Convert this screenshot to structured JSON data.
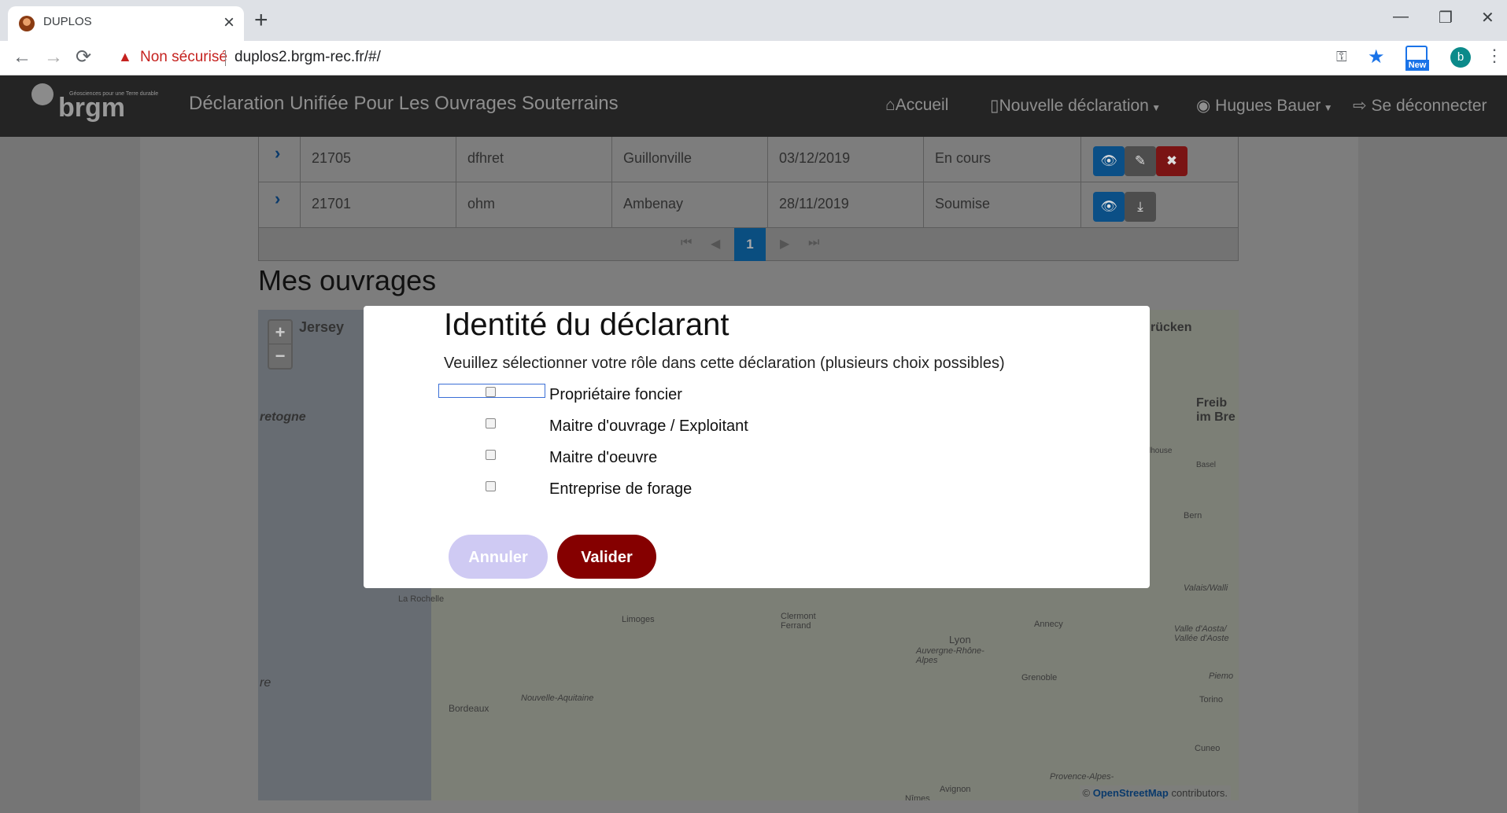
{
  "browser": {
    "tab_title": "DUPLOS",
    "security_warning": "Non sécurisé",
    "url": "duplos2.brgm-rec.fr/#/",
    "profile_initial": "b",
    "extension_badge": "New"
  },
  "navbar": {
    "logo_text": "brgm",
    "logo_tagline": "Géosciences pour une Terre durable",
    "app_title": "Déclaration Unifiée Pour Les Ouvrages Souterrains",
    "home": "Accueil",
    "new_declaration": "Nouvelle déclaration",
    "user": "Hugues Bauer",
    "logout": "Se déconnecter"
  },
  "table": {
    "rows": [
      {
        "id": "21705",
        "name": "dfhret",
        "commune": "Guillonville",
        "date": "03/12/2019",
        "status": "En cours"
      },
      {
        "id": "21701",
        "name": "ohm",
        "commune": "Ambenay",
        "date": "28/11/2019",
        "status": "Soumise"
      }
    ],
    "current_page": "1"
  },
  "section": {
    "title": "Mes ouvrages"
  },
  "map": {
    "labels": [
      "Jersey",
      "retogne",
      "La Rochelle",
      "Limoges",
      "Clermont Ferrand",
      "Lyon",
      "Auvergne-Rhône-Alpes",
      "Annecy",
      "Grenoble",
      "Bordeaux",
      "Nouvelle-Aquitaine",
      "Torino",
      "Cuneo",
      "Bern",
      "Basel",
      "Freib im Bre",
      "rücken",
      "Valais/Walli",
      "Valle d'Aosta/ Vallée d'Aoste",
      "Piemo",
      "Provence-Alpes-",
      "Nîmes",
      "Avignon",
      "lhouse",
      "re"
    ],
    "attribution_prefix": "©",
    "attribution_link": "OpenStreetMap",
    "attribution_suffix": "contributors."
  },
  "modal": {
    "title": "Identité du déclarant",
    "description": "Veuillez sélectionner votre rôle dans cette déclaration (plusieurs choix possibles)",
    "options": [
      "Propriétaire foncier",
      "Maitre d'ouvrage / Exploitant",
      "Maitre d'oeuvre",
      "Entreprise de forage"
    ],
    "cancel_label": "Annuler",
    "submit_label": "Valider"
  }
}
